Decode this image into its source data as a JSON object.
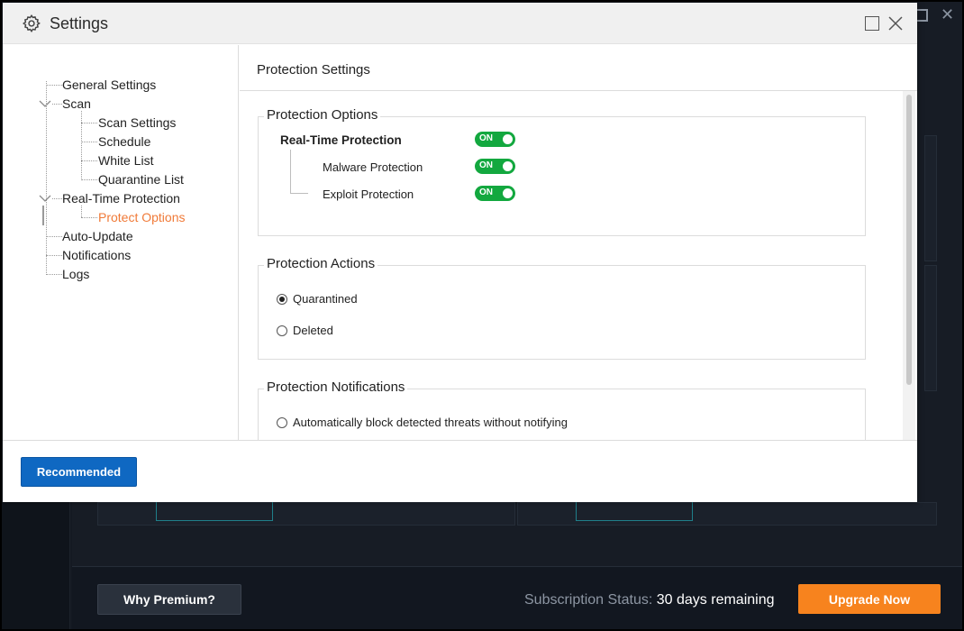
{
  "dialog": {
    "title": "Settings",
    "icons": {
      "title": "gear-icon",
      "maximize": "maximize-icon",
      "close": "close-icon"
    },
    "tree": [
      {
        "label": "General Settings"
      },
      {
        "label": "Scan",
        "expanded": true,
        "children": [
          {
            "label": "Scan Settings"
          },
          {
            "label": "Schedule"
          },
          {
            "label": "White List"
          },
          {
            "label": "Quarantine List"
          }
        ]
      },
      {
        "label": "Real-Time Protection",
        "expanded": true,
        "children": [
          {
            "label": "Protect Options",
            "active": true
          }
        ]
      },
      {
        "label": "Auto-Update"
      },
      {
        "label": "Notifications"
      },
      {
        "label": "Logs"
      }
    ],
    "panel": {
      "title": "Protection Settings",
      "options_group": {
        "legend": "Protection Options",
        "main": {
          "label": "Real-Time Protection",
          "toggle": "ON"
        },
        "sub": [
          {
            "label": "Malware Protection",
            "toggle": "ON"
          },
          {
            "label": "Exploit Protection",
            "toggle": "ON"
          }
        ]
      },
      "actions_group": {
        "legend": "Protection Actions",
        "options": [
          {
            "label": "Quarantined",
            "checked": true
          },
          {
            "label": "Deleted",
            "checked": false
          }
        ]
      },
      "notifications_group": {
        "legend": "Protection Notifications",
        "options": [
          {
            "label": "Automatically block detected threats without notifying",
            "checked": false
          }
        ]
      }
    },
    "footer": {
      "recommended_label": "Recommended"
    }
  },
  "app": {
    "footer": {
      "why_premium": "Why Premium?",
      "status_label": "Subscription Status:",
      "status_value": "30 days remaining",
      "upgrade_label": "Upgrade Now"
    }
  },
  "colors": {
    "accent_active": "#f07a38",
    "toggle_on": "#13a83f",
    "primary_button": "#0f68c2",
    "upgrade_button": "#f7831e"
  }
}
